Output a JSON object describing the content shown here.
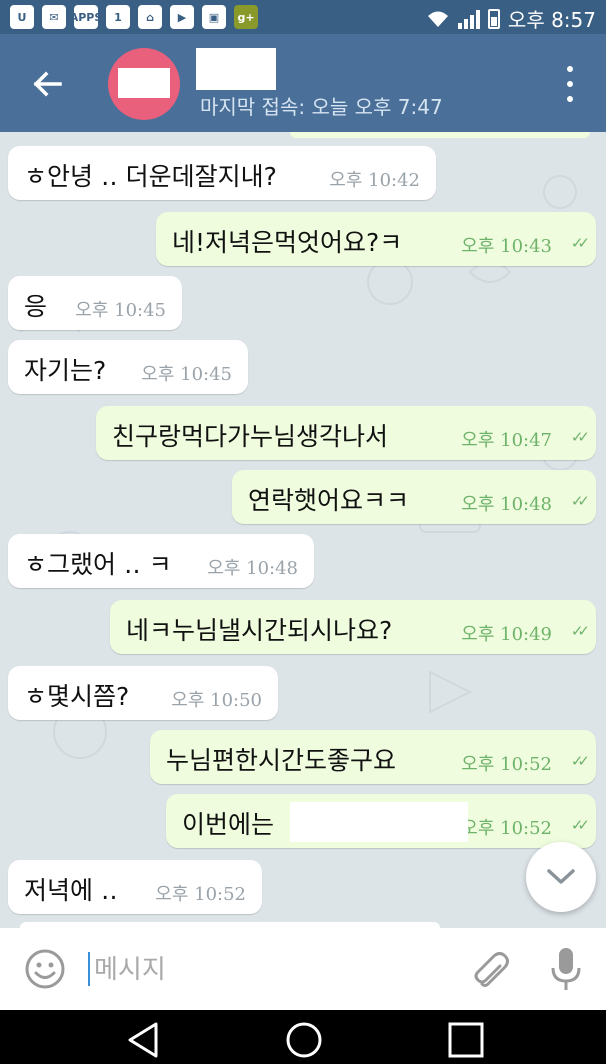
{
  "status_bar": {
    "icons": [
      "U",
      "mail",
      "APPS",
      "1",
      "home",
      "play",
      "bag",
      "g+"
    ],
    "time": "오후 8:57"
  },
  "header": {
    "last_seen": "마지막 접속: 오늘 오후 7:47",
    "avatar_color": "#e8607c",
    "header_color": "#4a7099"
  },
  "messages": [
    {
      "dir": "in",
      "text": "ㅎ안녕 ‥ 더운데잘지내?",
      "time": "오후 10:42"
    },
    {
      "dir": "out",
      "text": "네!저녁은먹엇어요?ㅋ",
      "time": "오후 10:43"
    },
    {
      "dir": "in",
      "text": "응",
      "time": "오후 10:45"
    },
    {
      "dir": "in",
      "text": "자기는?",
      "time": "오후 10:45"
    },
    {
      "dir": "out",
      "text": "친구랑먹다가누님생각나서",
      "time": "오후 10:47"
    },
    {
      "dir": "out",
      "text": "연락햇어요ㅋㅋ",
      "time": "오후 10:48"
    },
    {
      "dir": "in",
      "text": "ㅎ그랬어 ‥ ㅋ",
      "time": "오후 10:48"
    },
    {
      "dir": "out",
      "text": "네ㅋ누님낼시간되시나요?",
      "time": "오후 10:49"
    },
    {
      "dir": "in",
      "text": "ㅎ몇시쯤?",
      "time": "오후 10:50"
    },
    {
      "dir": "out",
      "text": "누님편한시간도좋구요",
      "time": "오후 10:52"
    },
    {
      "dir": "out",
      "text": "이번에는",
      "time": "오후 10:52"
    },
    {
      "dir": "in",
      "text": "저녁에 ‥",
      "time": "오후 10:52"
    }
  ],
  "input": {
    "placeholder": "메시지"
  },
  "colors": {
    "incoming_bubble": "#ffffff",
    "outgoing_bubble": "#effdde",
    "check_color": "#6fb36a",
    "chat_background": "#dde4e8"
  }
}
